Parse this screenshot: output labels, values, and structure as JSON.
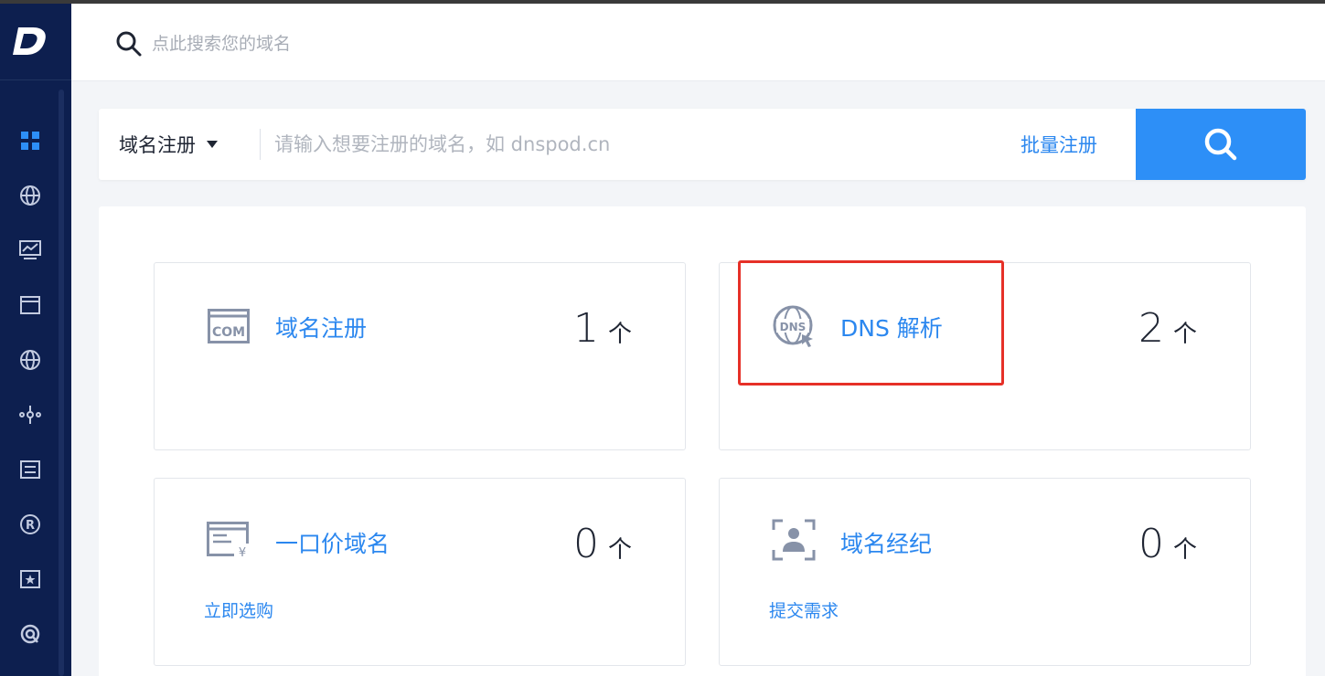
{
  "logo": {
    "letter": "D"
  },
  "topbar": {
    "search_placeholder": "点此搜索您的域名"
  },
  "sidebar": {
    "items": [
      {
        "icon": "dashboard-icon"
      },
      {
        "icon": "globe-icon"
      },
      {
        "icon": "monitor-icon"
      },
      {
        "icon": "window-icon"
      },
      {
        "icon": "globe-icon"
      },
      {
        "icon": "nodes-icon"
      },
      {
        "icon": "list-icon"
      },
      {
        "icon": "registered-icon"
      },
      {
        "icon": "star-box-icon"
      },
      {
        "icon": "support-icon"
      }
    ]
  },
  "searchbar": {
    "type_label": "域名注册",
    "placeholder": "请输入想要注册的域名，如 dnspod.cn",
    "batch_label": "批量注册"
  },
  "cards": [
    {
      "title": "域名注册",
      "count": "1",
      "unit": "个",
      "icon": "com-icon",
      "action": ""
    },
    {
      "title": "DNS 解析",
      "count": "2",
      "unit": "个",
      "icon": "dns-globe-icon",
      "action": ""
    },
    {
      "title": "一口价域名",
      "count": "0",
      "unit": "个",
      "icon": "price-tag-window-icon",
      "action": "立即选购"
    },
    {
      "title": "域名经纪",
      "count": "0",
      "unit": "个",
      "icon": "broker-person-icon",
      "action": "提交需求"
    }
  ],
  "colors": {
    "sidebar_bg": "#0d1f4f",
    "accent": "#2d8ff7",
    "link": "#2b87ef",
    "highlight": "#e63027"
  }
}
